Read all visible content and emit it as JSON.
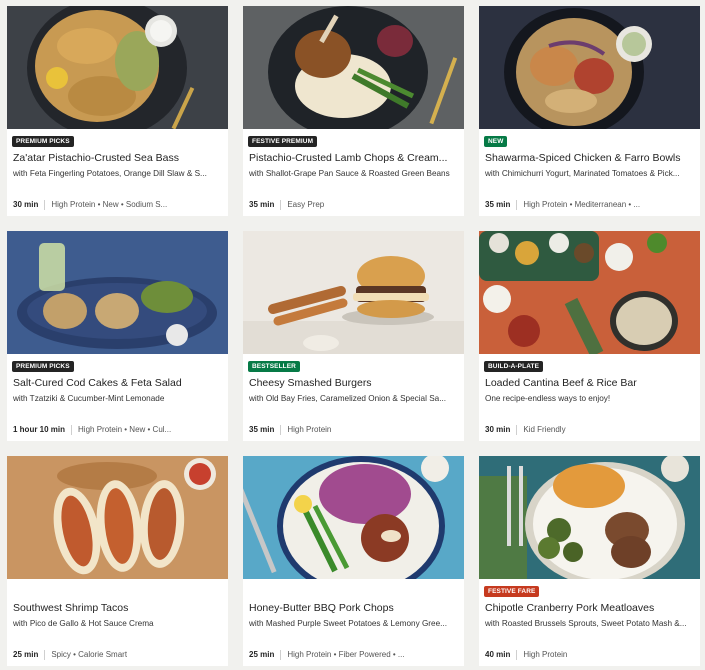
{
  "colors": {
    "badge_dark": "#242424",
    "badge_green": "#067a46",
    "badge_festive": "#c63a1f",
    "page_bg": "#f1f1ee"
  },
  "recipes": [
    {
      "badge": "PREMIUM PICKS",
      "badge_color": "#242424",
      "title": "Za'atar Pistachio-Crusted Sea Bass",
      "subtitle": "with Feta Fingerling Potatoes, Orange Dill Slaw & S...",
      "time": "30 min",
      "tags": "High Protein • New • Sodium S..."
    },
    {
      "badge": "FESTIVE PREMIUM",
      "badge_color": "#242424",
      "title": "Pistachio-Crusted Lamb Chops & Cream...",
      "subtitle": "with Shallot-Grape Pan Sauce & Roasted Green Beans",
      "time": "35 min",
      "tags": "Easy Prep"
    },
    {
      "badge": "NEW",
      "badge_color": "#067a46",
      "title": "Shawarma-Spiced Chicken & Farro Bowls",
      "subtitle": "with Chimichurri Yogurt, Marinated Tomatoes & Pick...",
      "time": "35 min",
      "tags": "High Protein • Mediterranean • ..."
    },
    {
      "badge": "PREMIUM PICKS",
      "badge_color": "#242424",
      "title": "Salt-Cured Cod Cakes & Feta Salad",
      "subtitle": "with Tzatziki & Cucumber-Mint Lemonade",
      "time": "1 hour 10 min",
      "tags": "High Protein • New • Cul..."
    },
    {
      "badge": "BESTSELLER",
      "badge_color": "#067a46",
      "title": "Cheesy Smashed Burgers",
      "subtitle": "with Old Bay Fries, Caramelized Onion & Special Sa...",
      "time": "35 min",
      "tags": "High Protein"
    },
    {
      "badge": "BUILD-A-PLATE",
      "badge_color": "#242424",
      "title": "Loaded Cantina Beef & Rice Bar",
      "subtitle": "One recipe-endless ways to enjoy!",
      "time": "30 min",
      "tags": "Kid Friendly"
    },
    {
      "badge": "",
      "badge_color": "",
      "title": "Southwest Shrimp Tacos",
      "subtitle": "with Pico de Gallo & Hot Sauce Crema",
      "time": "25 min",
      "tags": "Spicy • Calorie Smart"
    },
    {
      "badge": "",
      "badge_color": "",
      "title": "Honey-Butter BBQ Pork Chops",
      "subtitle": "with Mashed Purple Sweet Potatoes & Lemony Gree...",
      "time": "25 min",
      "tags": "High Protein • Fiber Powered • ..."
    },
    {
      "badge": "FESTIVE FARE",
      "badge_color": "#c63a1f",
      "title": "Chipotle Cranberry Pork Meatloaves",
      "subtitle": "with Roasted Brussels Sprouts, Sweet Potato Mash &...",
      "time": "40 min",
      "tags": "High Protein"
    }
  ]
}
